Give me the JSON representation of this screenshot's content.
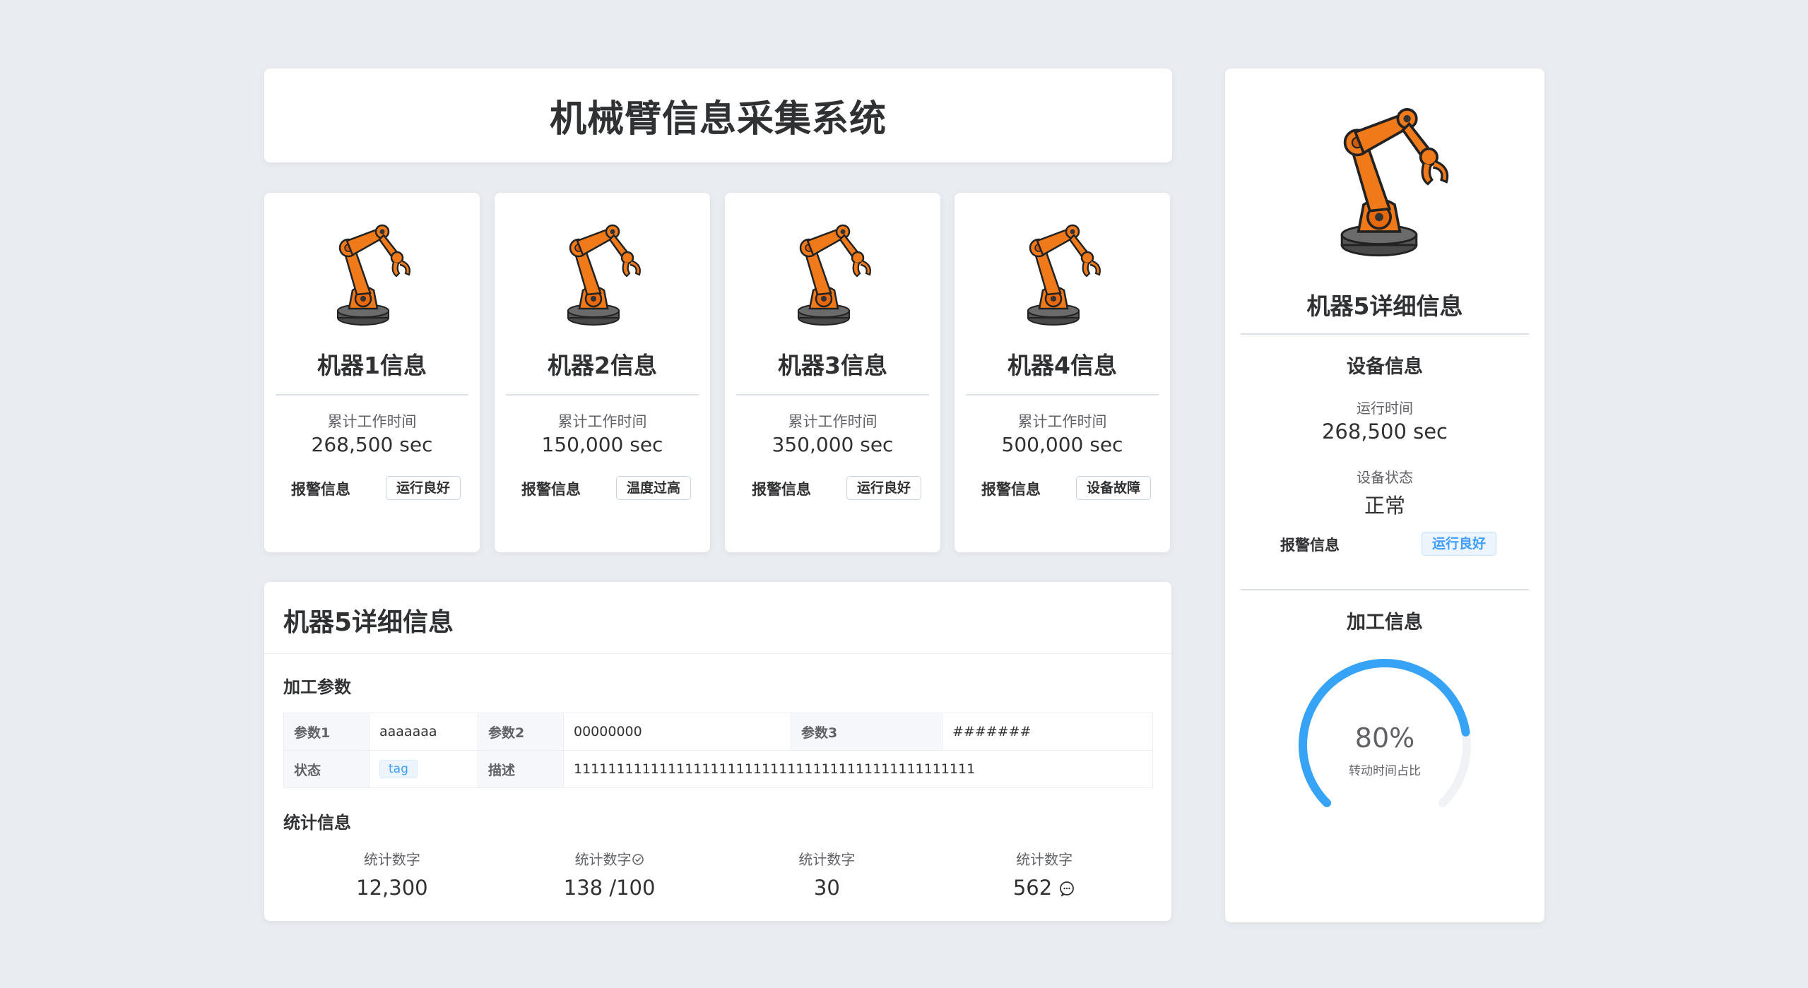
{
  "title": "机械臂信息采集系统",
  "machines": [
    {
      "name": "机器1信息",
      "stat_label": "累计工作时间",
      "stat_value": "268,500 sec",
      "alarm_label": "报警信息",
      "alarm_status": "运行良好"
    },
    {
      "name": "机器2信息",
      "stat_label": "累计工作时间",
      "stat_value": "150,000 sec",
      "alarm_label": "报警信息",
      "alarm_status": "温度过高"
    },
    {
      "name": "机器3信息",
      "stat_label": "累计工作时间",
      "stat_value": "350,000 sec",
      "alarm_label": "报警信息",
      "alarm_status": "运行良好"
    },
    {
      "name": "机器4信息",
      "stat_label": "累计工作时间",
      "stat_value": "500,000 sec",
      "alarm_label": "报警信息",
      "alarm_status": "设备故障"
    }
  ],
  "details": {
    "title": "机器5详细信息",
    "params_heading": "加工参数",
    "params": {
      "p1_label": "参数1",
      "p1_value": "aaaaaaa",
      "p2_label": "参数2",
      "p2_value": "00000000",
      "p3_label": "参数3",
      "p3_value": "#######",
      "status_label": "状态",
      "status_tag": "tag",
      "desc_label": "描述",
      "desc_value": "11111111111111111111111111111111111111111111111"
    },
    "stats_heading": "统计信息",
    "stats": [
      {
        "label": "统计数字",
        "value": "12,300",
        "icon": ""
      },
      {
        "label": "统计数字",
        "value": "138 /100",
        "icon": "check-circle-icon"
      },
      {
        "label": "统计数字",
        "value": "30",
        "icon": ""
      },
      {
        "label": "统计数字",
        "value": "562",
        "icon": "chat-icon"
      }
    ]
  },
  "side": {
    "title": "机器5详细信息",
    "device_heading": "设备信息",
    "runtime_label": "运行时间",
    "runtime_value": "268,500 sec",
    "state_label": "设备状态",
    "state_value": "正常",
    "alarm_label": "报警信息",
    "alarm_status": "运行良好",
    "process_heading": "加工信息",
    "gauge": {
      "percent": 80,
      "value_text": "80%",
      "label": "转动时间占比"
    }
  },
  "colors": {
    "background": "#e9ecf1",
    "accent": "#409eff",
    "gauge": "#36a3f7",
    "robot": "#f07a1a"
  }
}
